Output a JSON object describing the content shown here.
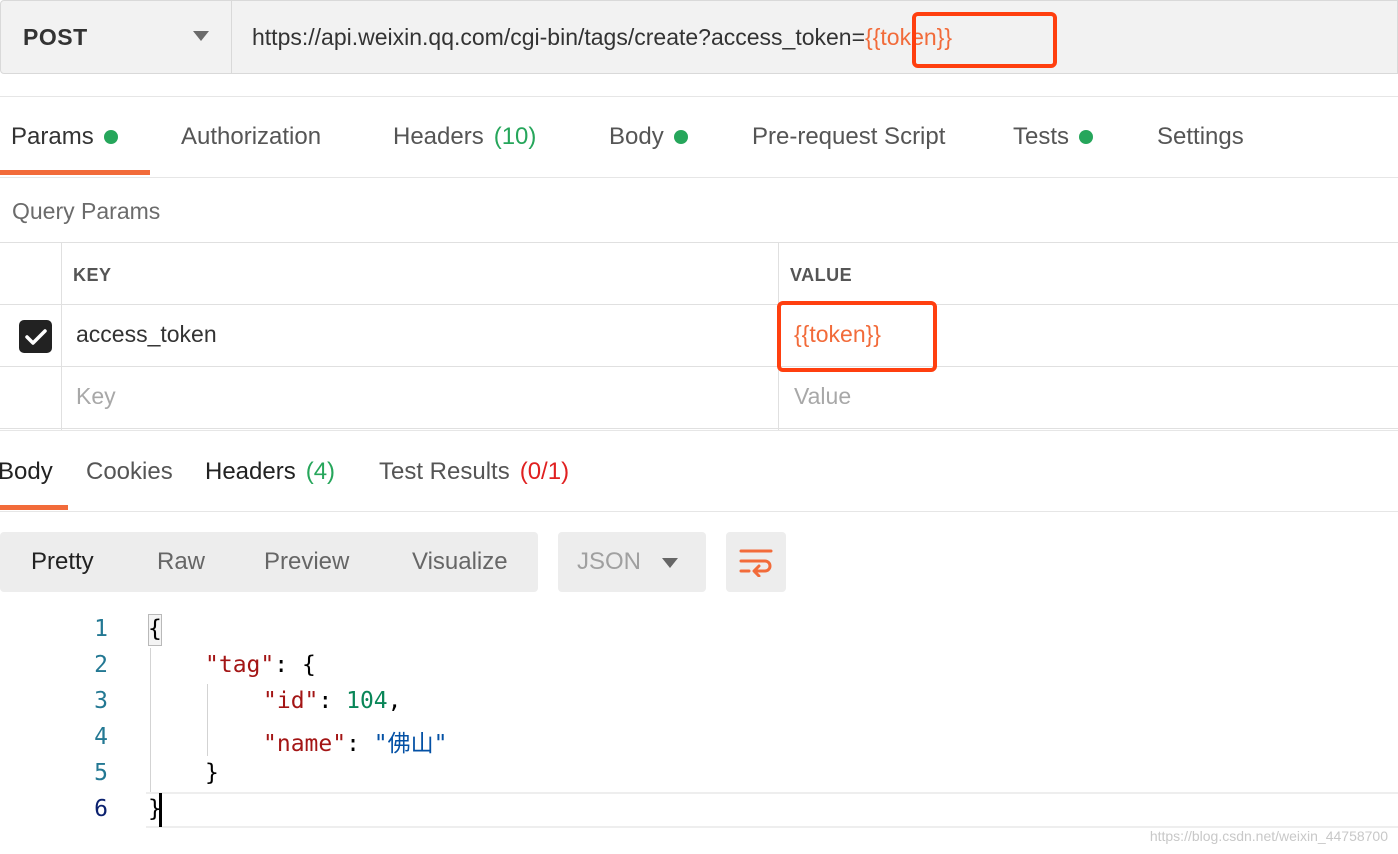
{
  "request": {
    "method": "POST",
    "url_prefix": "https://api.weixin.qq.com/cgi-bin/tags/create?access_token=",
    "url_variable": "{{token}}"
  },
  "request_tabs": [
    {
      "label": "Params",
      "dot": true
    },
    {
      "label": "Authorization",
      "dot": false
    },
    {
      "label": "Headers",
      "count": "(10)"
    },
    {
      "label": "Body",
      "dot": true
    },
    {
      "label": "Pre-request Script",
      "dot": false
    },
    {
      "label": "Tests",
      "dot": true
    },
    {
      "label": "Settings",
      "dot": false
    }
  ],
  "query_params": {
    "title": "Query Params",
    "key_header": "KEY",
    "value_header": "VALUE",
    "rows": [
      {
        "checked": true,
        "key": "access_token",
        "value": "{{token}}"
      }
    ],
    "key_placeholder": "Key",
    "value_placeholder": "Value"
  },
  "response_tabs": [
    {
      "label": "Body"
    },
    {
      "label": "Cookies"
    },
    {
      "label": "Headers",
      "count": "(4)"
    },
    {
      "label": "Test Results",
      "count": "(0/1)"
    }
  ],
  "view_modes": [
    "Pretty",
    "Raw",
    "Preview",
    "Visualize"
  ],
  "format": "JSON",
  "wrap_icon": "wrap-lines-icon",
  "code": {
    "line_numbers": [
      "1",
      "2",
      "3",
      "4",
      "5",
      "6"
    ],
    "open_brace": "{",
    "tag_key": "\"tag\"",
    "tag_sep": ": {",
    "id_key": "\"id\"",
    "id_sep": ": ",
    "id_value": "104",
    "id_comma": ",",
    "name_key": "\"name\"",
    "name_sep": ": ",
    "name_value": "\"佛山\"",
    "inner_close": "}",
    "close_brace": "}"
  },
  "watermark": "https://blog.csdn.net/weixin_44758700",
  "colors": {
    "accent": "#f26b3a",
    "dot_green": "#26a65b",
    "highlight_box": "#ff3f0f",
    "error_red": "#e02020"
  }
}
